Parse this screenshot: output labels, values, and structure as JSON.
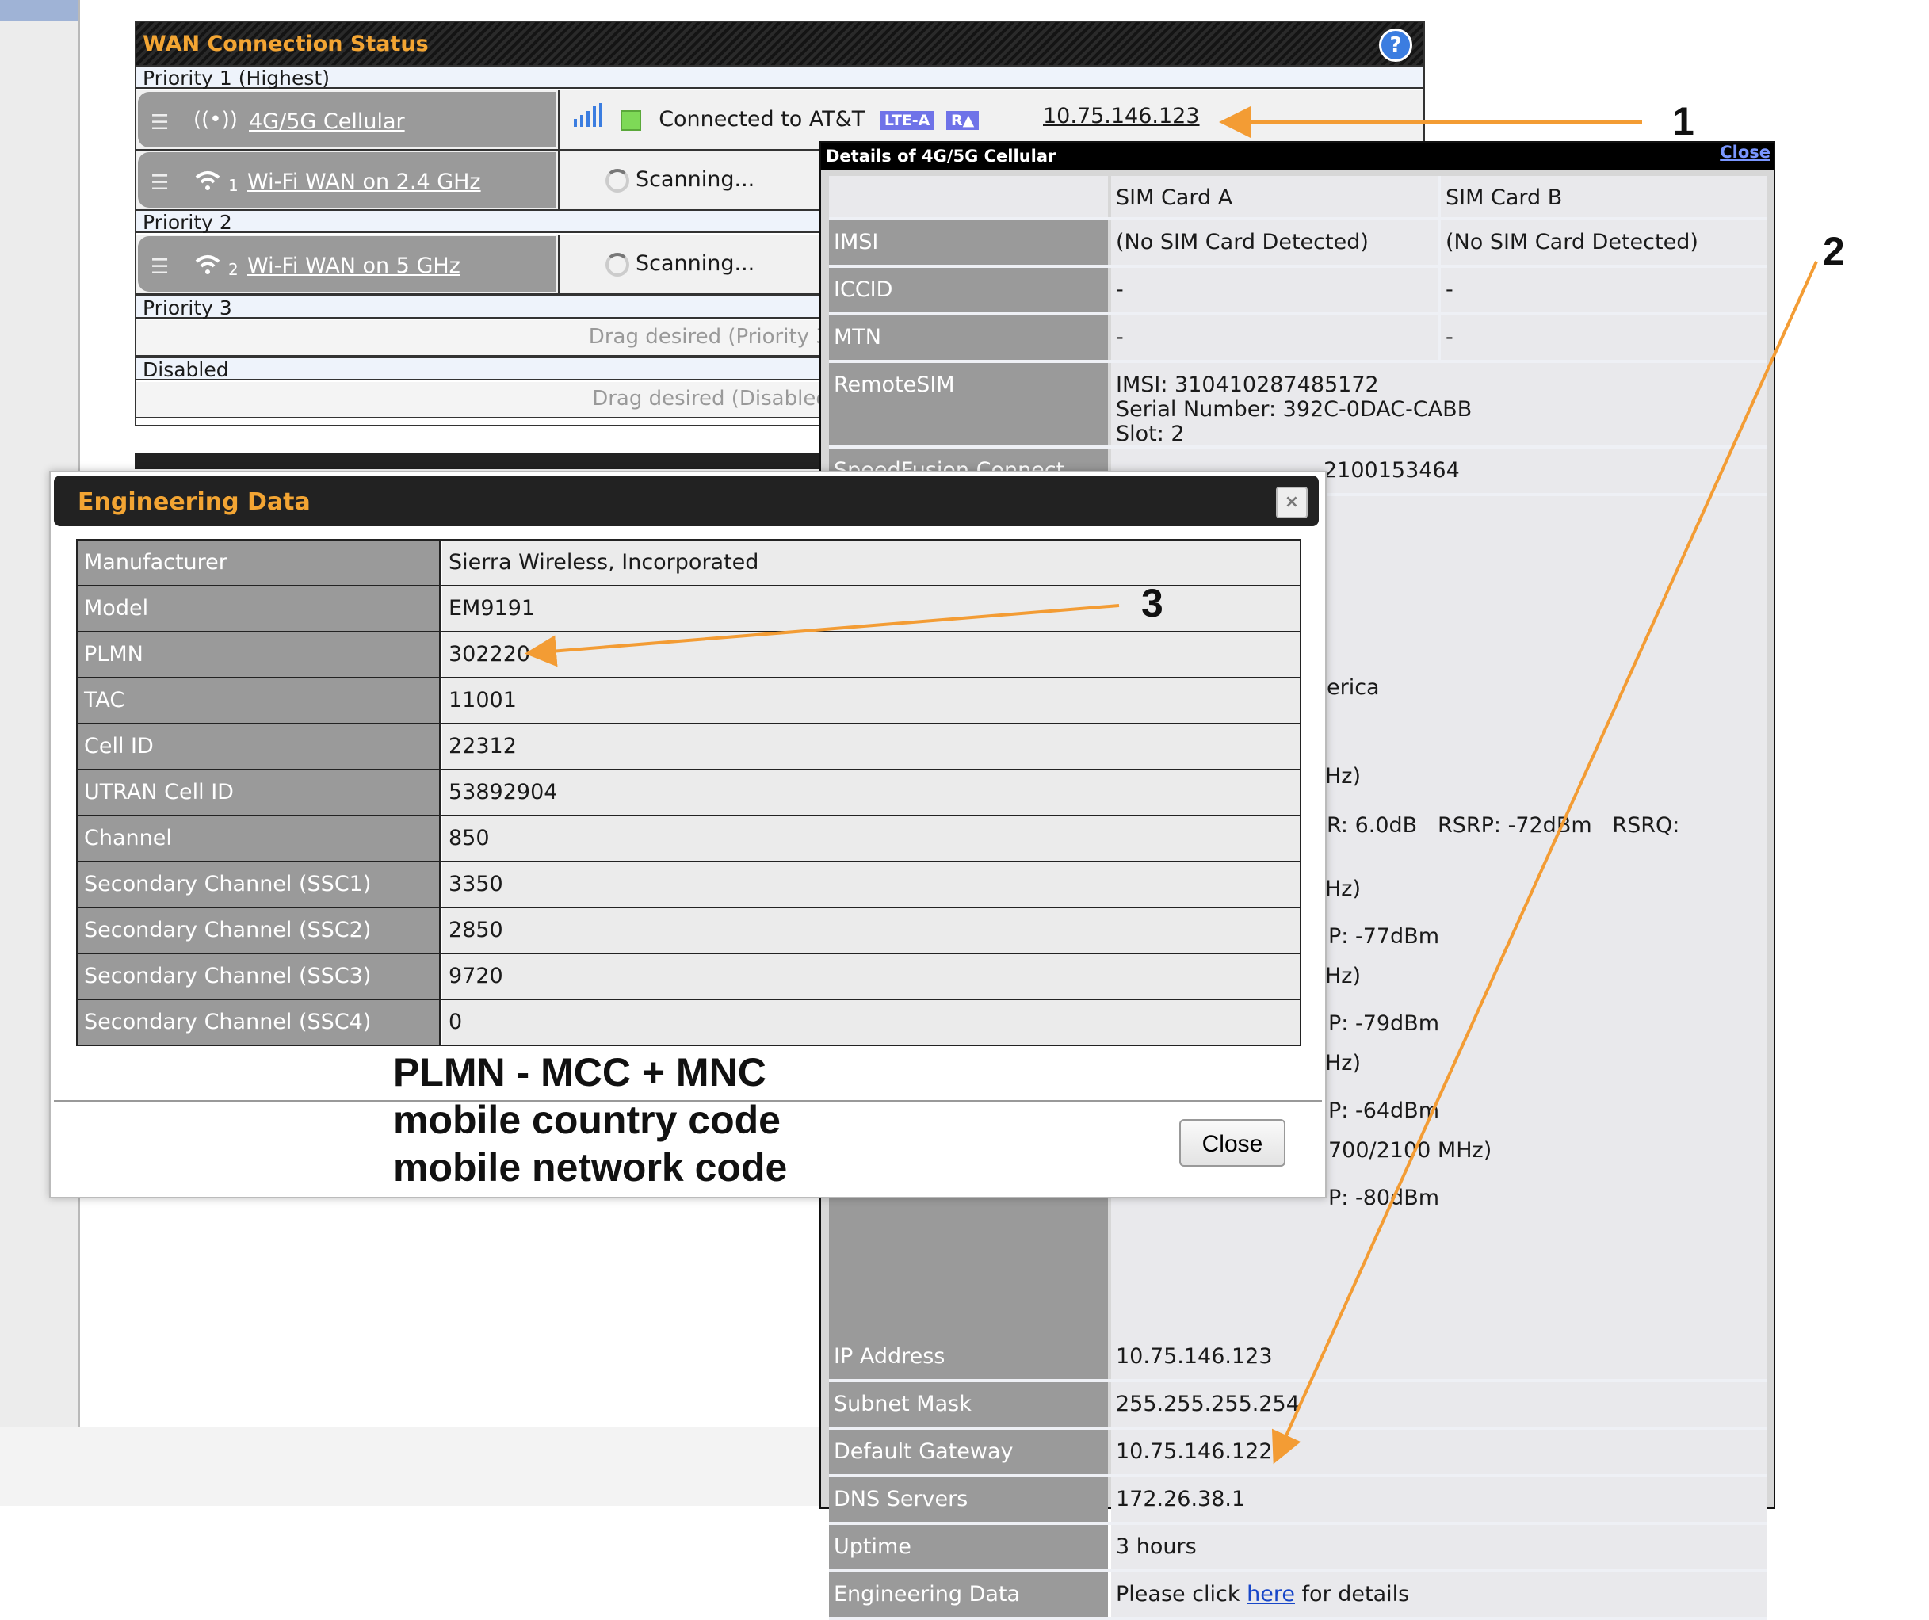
{
  "wan": {
    "title": "WAN Connection Status",
    "help_icon": "?",
    "priority1": "Priority 1 (Highest)",
    "priority2": "Priority 2",
    "priority3": "Priority 3",
    "disabled": "Disabled",
    "drag_p3": "Drag desired (Priority 3)",
    "drag_disabled": "Drag desired (Disabled)",
    "connections": [
      {
        "name": "4G/5G Cellular",
        "status": "Connected to AT&T",
        "badges": [
          "LTE-A",
          "R▲"
        ],
        "ip": "10.75.146.123"
      },
      {
        "num": "1",
        "name": "Wi-Fi WAN on 2.4 GHz",
        "status": "Scanning..."
      },
      {
        "num": "2",
        "name": "Wi-Fi WAN on 5 GHz",
        "status": "Scanning..."
      }
    ]
  },
  "details": {
    "title": "Details of 4G/5G Cellular",
    "close": "Close",
    "sim_a": "SIM Card A",
    "sim_b": "SIM Card B",
    "rows": {
      "imsi": {
        "label": "IMSI",
        "a": "(No SIM Card Detected)",
        "b": "(No SIM Card Detected)"
      },
      "iccid": {
        "label": "ICCID",
        "a": "-",
        "b": "-"
      },
      "mtn": {
        "label": "MTN",
        "a": "-",
        "b": "-"
      },
      "remotesim": {
        "label": "RemoteSIM",
        "line1": "IMSI: 310410287485172",
        "line2": "Serial Number: 392C-0DAC-CABB",
        "line3": "Slot: 2"
      },
      "speedfusion": {
        "label": "SpeedFusion Connect",
        "value": "2100153464"
      }
    },
    "fragments": {
      "f1": "erica",
      "f2": "Hz)",
      "f3": "R: 6.0dB   RSRP: -72dBm   RSRQ:",
      "f4": "Hz)",
      "f5": "P: -77dBm",
      "f6": "Hz)",
      "f7": "P: -79dBm",
      "f8": "Hz)",
      "f9": "P: -64dBm",
      "f10": "700/2100 MHz)",
      "f11": "P: -80dBm"
    },
    "bottom_rows": [
      {
        "label": "IP Address",
        "value": "10.75.146.123"
      },
      {
        "label": "Subnet Mask",
        "value": "255.255.255.254"
      },
      {
        "label": "Default Gateway",
        "value": "10.75.146.122"
      },
      {
        "label": "DNS Servers",
        "value": "172.26.38.1"
      },
      {
        "label": "Uptime",
        "value": "3 hours"
      }
    ],
    "engineering": {
      "label": "Engineering Data",
      "prefix": "Please click ",
      "link": "here",
      "suffix": " for details"
    }
  },
  "engineering_dialog": {
    "title": "Engineering Data",
    "close_x": "×",
    "rows": [
      {
        "label": "Manufacturer",
        "value": "Sierra Wireless, Incorporated"
      },
      {
        "label": "Model",
        "value": "EM9191"
      },
      {
        "label": "PLMN",
        "value": "302220"
      },
      {
        "label": "TAC",
        "value": "11001"
      },
      {
        "label": "Cell ID",
        "value": "22312"
      },
      {
        "label": "UTRAN Cell ID",
        "value": "53892904"
      },
      {
        "label": "Channel",
        "value": "850"
      },
      {
        "label": "Secondary Channel (SSC1)",
        "value": "3350"
      },
      {
        "label": "Secondary Channel (SSC2)",
        "value": "2850"
      },
      {
        "label": "Secondary Channel (SSC3)",
        "value": "9720"
      },
      {
        "label": "Secondary Channel (SSC4)",
        "value": "0"
      }
    ],
    "close_button": "Close"
  },
  "annotations": {
    "note_line1": "PLMN - MCC + MNC",
    "note_line2": "mobile country code",
    "note_line3": "mobile network code",
    "marker1": "1",
    "marker2": "2",
    "marker3": "3",
    "arrow_color": "#f39c34"
  },
  "colors": {
    "accent_orange": "#f3a533",
    "link_blue": "#1746c8",
    "status_green": "#7ed957",
    "badge_purple": "#6f73e8"
  }
}
